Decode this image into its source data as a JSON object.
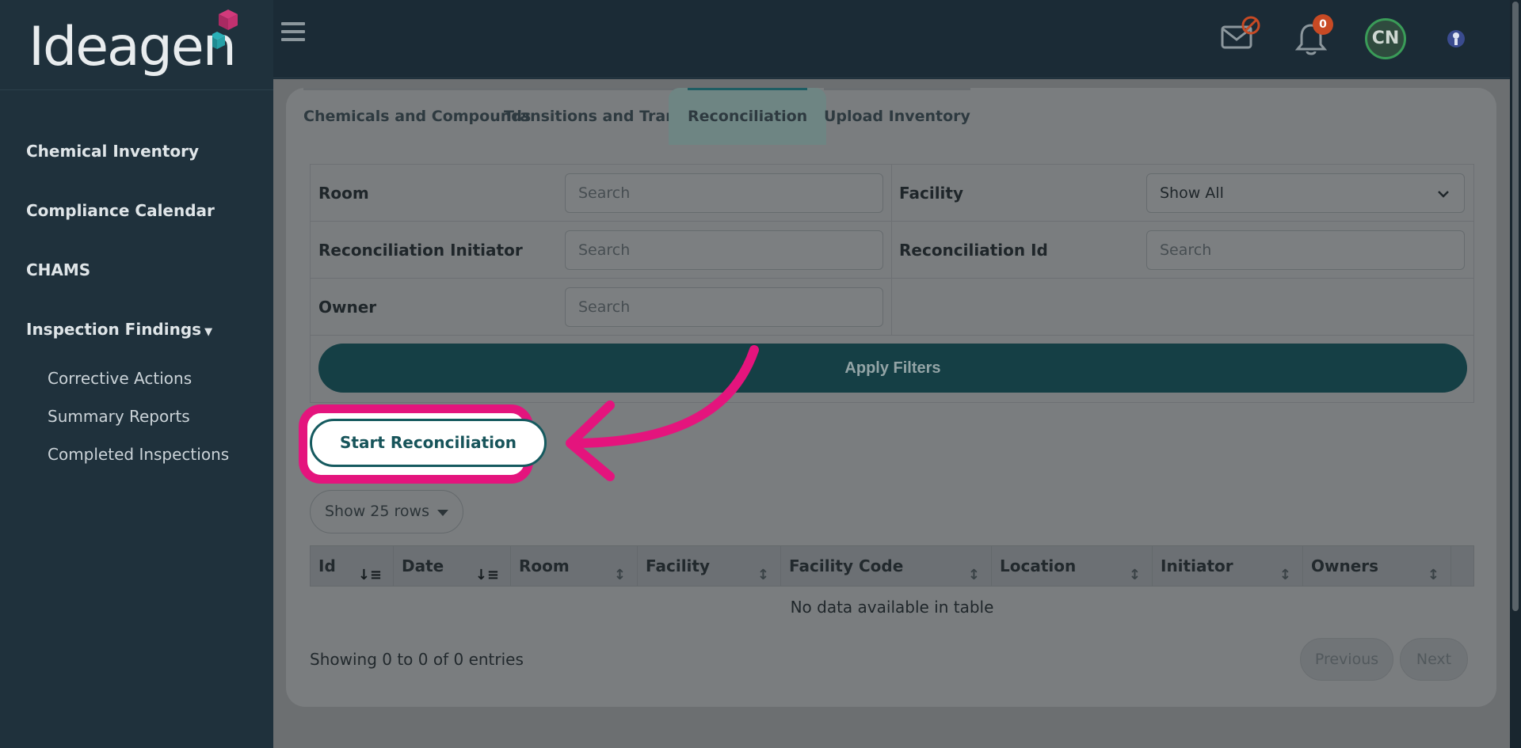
{
  "app": {
    "logo_text": "Ideagen"
  },
  "sidebar": {
    "items": [
      {
        "label": "Chemical Inventory"
      },
      {
        "label": "Compliance Calendar"
      },
      {
        "label": "CHAMS"
      },
      {
        "label": "Inspection Findings"
      }
    ],
    "sub_items": [
      {
        "label": "Corrective Actions"
      },
      {
        "label": "Summary Reports"
      },
      {
        "label": "Completed Inspections"
      }
    ]
  },
  "header": {
    "notification_count": "0",
    "avatar_initials": "CN"
  },
  "tabs": [
    {
      "label": "Chemicals and Compounds"
    },
    {
      "label": "Transitions and Transfers"
    },
    {
      "label": "Reconciliation",
      "active": true
    },
    {
      "label": "Upload Inventory"
    }
  ],
  "filters": {
    "room_label": "Room",
    "room_placeholder": "Search",
    "facility_label": "Facility",
    "facility_value": "Show All",
    "initiator_label": "Reconciliation Initiator",
    "initiator_placeholder": "Search",
    "recon_id_label": "Reconciliation Id",
    "recon_id_placeholder": "Search",
    "owner_label": "Owner",
    "owner_placeholder": "Search",
    "apply_label": "Apply Filters"
  },
  "actions": {
    "start_label": "Start Reconciliation"
  },
  "table": {
    "rows_select": "Show 25 rows",
    "columns": [
      "Id",
      "Date",
      "Room",
      "Facility",
      "Facility Code",
      "Location",
      "Initiator",
      "Owners"
    ],
    "empty_message": "No data available in table",
    "showing": "Showing 0 to 0 of 0 entries",
    "prev_label": "Previous",
    "next_label": "Next"
  },
  "colors": {
    "accent": "#155a5f",
    "highlight": "#e4147d",
    "badge": "#c84a24"
  }
}
